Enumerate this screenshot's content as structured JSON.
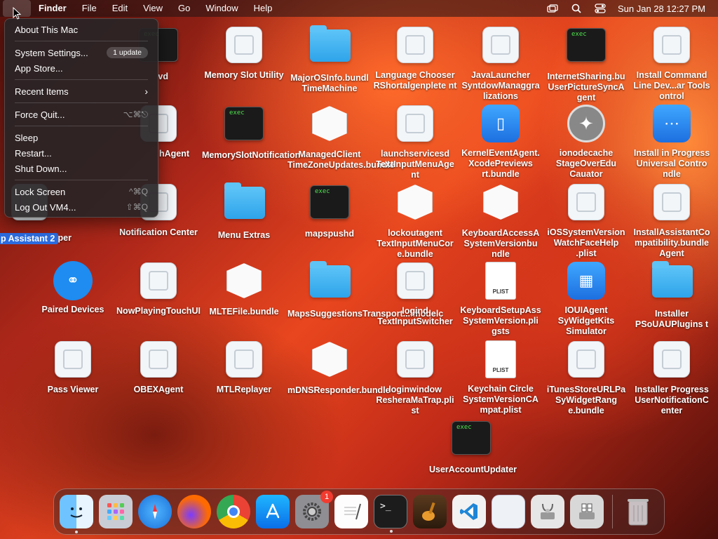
{
  "menubar": {
    "app_name": "Finder",
    "menus": [
      "File",
      "Edit",
      "View",
      "Go",
      "Window",
      "Help"
    ],
    "clock": "Sun Jan 28  12:27 PM",
    "status_icons": [
      "screen-mirror-icon",
      "spotlight-icon",
      "control-center-icon"
    ]
  },
  "apple_menu": {
    "about": "About This Mac",
    "settings": "System Settings...",
    "settings_badge": "1 update",
    "app_store": "App Store...",
    "recent": "Recent Items",
    "recent_chevron": "›",
    "force_quit": "Force Quit...",
    "force_quit_shortcut": "⌥⌘⎋",
    "sleep": "Sleep",
    "restart": "Restart...",
    "shutdown": "Shut Down...",
    "lock": "Lock Screen",
    "lock_shortcut": "^⌘Q",
    "logout": "Log Out VM4...",
    "logout_shortcut": "⇧⌘Q"
  },
  "selected_label": "p Assistant 2",
  "desktop": {
    "col2": [
      "Memory Slot Utility",
      "MemorySlotNotification",
      "Menu Extras",
      "MLTEFile.bundle",
      "MTLReplayer"
    ],
    "col1": [
      "vd",
      "hAgent",
      "Notification Center",
      "NowPlayingTouchUI",
      "OBEXAgent"
    ],
    "col0": [
      "SOUIHelper",
      "Paired Devices",
      "Pass Viewer"
    ],
    "col3": [
      "MajorOSInfo.bundl TimeMachine",
      "ManagedClient TimeZoneUpdates.bundle",
      "mapspushd",
      "MapsSuggestionsTransport...lmodelc",
      "mDNSResponder.bundle"
    ],
    "col4": [
      "Language Chooser RShortalgenplete nt",
      "launchservicesd TextInputMenuAge nt",
      "lockoutagent TextInputMenuCor e.bundle",
      "logind TextInputSwitcher",
      "loginwindow ResheraMaTrap.pli st"
    ],
    "col5": [
      "JavaLauncher SyntdowManaggra lizations",
      "KernelEventAgent. XcodePreviews rt.bundle",
      "KeyboardAccessA SystemVersionbu ndle",
      "KeyboardSetupAss SystemVersion.pli gsts",
      "Keychain Circle SystemVersionCA mpat.plist"
    ],
    "col6": [
      "InternetSharing.bu UserPictureSyncA gent",
      "ionodecache StageOverEdu Cauator",
      "iOSSystemVersion WatchFaceHelp .plist",
      "IOUIAgent SyWidgetKits Simulator",
      "iTunesStoreURLPa SyWidgetRang e.bundle"
    ],
    "col7": [
      "Install Command Line Dev...ar Tools ontrol",
      "Install in Progress Universal Contro ndle",
      "InstallAssistantCo mpatibility.bundle Agent",
      "Installer PSoUAUPlugins t",
      "Installer Progress UserNotificationC enter"
    ],
    "extra": "UserAccountUpdater"
  },
  "dock": {
    "apps": [
      "Finder",
      "Launchpad",
      "Safari",
      "Firefox",
      "Chrome",
      "App Store",
      "System Settings",
      "TextEdit",
      "Terminal",
      "GarageBand",
      "VS Code",
      "Generic",
      "Disk Utility",
      "Boot Camp",
      "Trash"
    ],
    "settings_badge": "1",
    "exec_label": "exec",
    "terminal_prompt": ">_"
  }
}
